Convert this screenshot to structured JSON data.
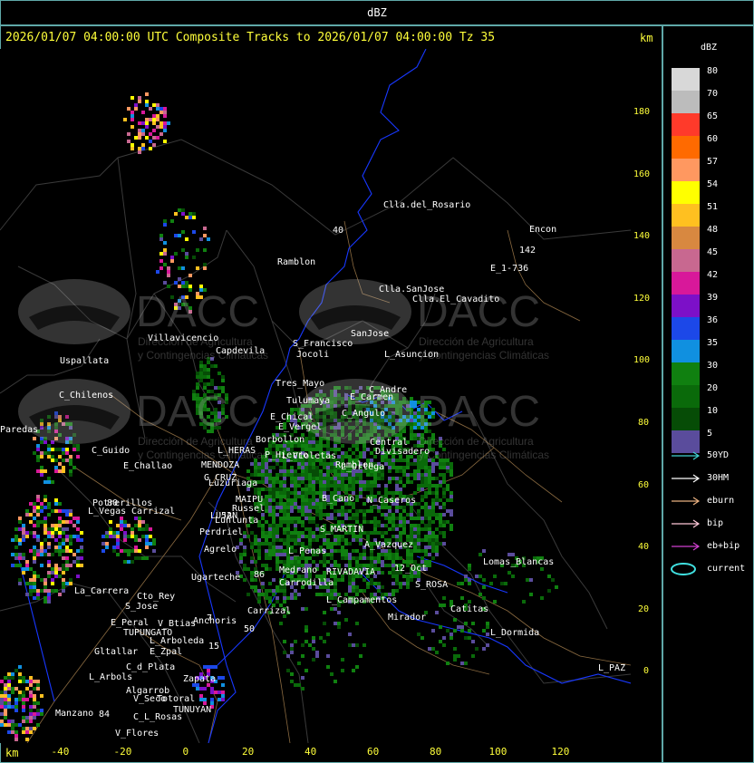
{
  "header": {
    "unit": "dBZ"
  },
  "title": "2026/01/07 04:00:00 UTC Composite Tracks to 2026/01/07 04:00:00 Tz 35",
  "axis": {
    "unit_top": "km",
    "unit_bottom": "km",
    "y_ticks": [
      "180",
      "160",
      "140",
      "120",
      "100",
      "80",
      "60",
      "40",
      "20",
      "0"
    ],
    "x_ticks": [
      "-40",
      "-20",
      "0",
      "20",
      "40",
      "60",
      "80",
      "100",
      "120"
    ]
  },
  "legend": {
    "title": "dBZ",
    "levels": [
      {
        "label": "80",
        "color": "#d8d8d8"
      },
      {
        "label": "70",
        "color": "#bcbcbc"
      },
      {
        "label": "65",
        "color": "#ff3a2a"
      },
      {
        "label": "60",
        "color": "#ff6a00"
      },
      {
        "label": "57",
        "color": "#ff9860"
      },
      {
        "label": "54",
        "color": "#ffff00"
      },
      {
        "label": "51",
        "color": "#ffc020"
      },
      {
        "label": "48",
        "color": "#d88840"
      },
      {
        "label": "45",
        "color": "#c86890"
      },
      {
        "label": "42",
        "color": "#d8189a"
      },
      {
        "label": "39",
        "color": "#7c10c8"
      },
      {
        "label": "36",
        "color": "#1c48e8"
      },
      {
        "label": "35",
        "color": "#1090e0"
      },
      {
        "label": "30",
        "color": "#108010"
      },
      {
        "label": "20",
        "color": "#0a6a0a"
      },
      {
        "label": "10",
        "color": "#064c06"
      },
      {
        "label": "5",
        "color": "#5a4c9c"
      }
    ],
    "tracks": [
      {
        "label": "50YD",
        "color": "#40d0d0"
      },
      {
        "label": "30HM",
        "color": "#ffffff"
      },
      {
        "label": "eburn",
        "color": "#e8b080"
      },
      {
        "label": "bip",
        "color": "#ffc8d8"
      },
      {
        "label": "eb+bip",
        "color": "#d040d0"
      },
      {
        "label": "current",
        "color": "#40e0e0"
      }
    ]
  },
  "watermark": {
    "brand": "DACC",
    "line1": "Dirección de Agricultura",
    "line2": "y Contingencias Climáticas"
  },
  "places": [
    {
      "name": "Clla.del_Rosario"
    },
    {
      "name": "Encon"
    },
    {
      "name": "Ramblon"
    },
    {
      "name": "142"
    },
    {
      "name": "E_1-736"
    },
    {
      "name": "Clla.SanJose"
    },
    {
      "name": "Clla.El_Cavadito"
    },
    {
      "name": "Villavicencio"
    },
    {
      "name": "Capdevila"
    },
    {
      "name": "S_Francisco"
    },
    {
      "name": "SanJose"
    },
    {
      "name": "Uspallata"
    },
    {
      "name": "Jocoli"
    },
    {
      "name": "L_Asuncion"
    },
    {
      "name": "Tres_Mayo"
    },
    {
      "name": "C_Andre"
    },
    {
      "name": "C_Chilenos"
    },
    {
      "name": "Tulumaya"
    },
    {
      "name": "E_Carmen"
    },
    {
      "name": "E_Chical"
    },
    {
      "name": "E_Vergel"
    },
    {
      "name": "C_Angulo"
    },
    {
      "name": "Paredas"
    },
    {
      "name": "Borbollon"
    },
    {
      "name": "L_Violetas"
    },
    {
      "name": "P_Hierro"
    },
    {
      "name": "L_HERAS"
    },
    {
      "name": "C_Guido"
    },
    {
      "name": "E_Challao"
    },
    {
      "name": "MENDOZA"
    },
    {
      "name": "G_CRUZ"
    },
    {
      "name": "Luzuriaga"
    },
    {
      "name": "Central"
    },
    {
      "name": "Divisadero"
    },
    {
      "name": "Ramblon"
    },
    {
      "name": "L_Ortega"
    },
    {
      "name": "MAIPU"
    },
    {
      "name": "Russel"
    },
    {
      "name": "B_Cano"
    },
    {
      "name": "N_Caseros"
    },
    {
      "name": "Potrerillos"
    },
    {
      "name": "L_Vegas"
    },
    {
      "name": "Carrizal"
    },
    {
      "name": "LUJAN"
    },
    {
      "name": "Lunlunta"
    },
    {
      "name": "S_MARTIN"
    },
    {
      "name": "Perdriel"
    },
    {
      "name": "A_Vazquez"
    },
    {
      "name": "Agrelo"
    },
    {
      "name": "L_Penas"
    },
    {
      "name": "Ugarteche"
    },
    {
      "name": "Medrano"
    },
    {
      "name": "RIVADAVIA"
    },
    {
      "name": "12_Oct"
    },
    {
      "name": "Lomas_Blancas"
    },
    {
      "name": "La_Carrera"
    },
    {
      "name": "Cto_Rey"
    },
    {
      "name": "S_Jose"
    },
    {
      "name": "Carrodilla"
    },
    {
      "name": "L_Campamentos"
    },
    {
      "name": "S_ROSA"
    },
    {
      "name": "Catitas"
    },
    {
      "name": "Carrizal"
    },
    {
      "name": "E_Peral"
    },
    {
      "name": "V_Btias"
    },
    {
      "name": "Anchoris"
    },
    {
      "name": "TUPUNGATO"
    },
    {
      "name": "Mirador"
    },
    {
      "name": "L_Dormida"
    },
    {
      "name": "L_Arboleda"
    },
    {
      "name": "Gltallar"
    },
    {
      "name": "E_Zpal"
    },
    {
      "name": "C_d_Plata"
    },
    {
      "name": "L_PAZ"
    },
    {
      "name": "L_Arbols"
    },
    {
      "name": "Zapata"
    },
    {
      "name": "Algarrob"
    },
    {
      "name": "V_Seco"
    },
    {
      "name": "Totoral"
    },
    {
      "name": "TUNUYAN"
    },
    {
      "name": "Manzano"
    },
    {
      "name": "C_L_Rosas"
    },
    {
      "name": "V_Flores"
    },
    {
      "name": "80"
    },
    {
      "name": "84"
    },
    {
      "name": "40"
    },
    {
      "name": "15"
    },
    {
      "name": "7"
    },
    {
      "name": "50"
    },
    {
      "name": "52"
    },
    {
      "name": "86"
    }
  ]
}
